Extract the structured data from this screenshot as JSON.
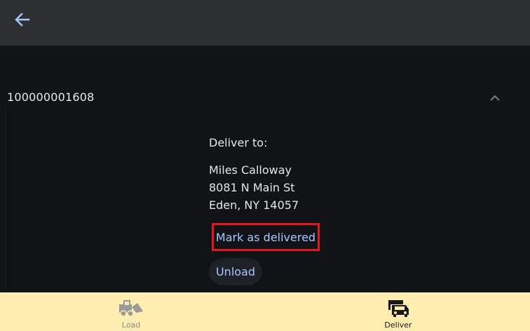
{
  "appbar": {
    "back_icon": "arrow-left-icon"
  },
  "order": {
    "id": "100000001608",
    "collapse_icon": "chevron-up-icon"
  },
  "delivery": {
    "label": "Deliver to:",
    "name": "Miles Calloway",
    "street": "8081 N Main St",
    "city_line": "Eden, NY 14057"
  },
  "actions": {
    "mark_delivered": "Mark as delivered",
    "unload": "Unload"
  },
  "bottom_nav": {
    "load": {
      "label": "Load",
      "icon": "loader-truck-icon"
    },
    "deliver": {
      "label": "Deliver",
      "icon": "delivery-vehicle-icon",
      "selected": true
    }
  },
  "colors": {
    "accent": "#a9c7ff",
    "highlight": "#e0191e",
    "nav_bg": "#ffeeb0",
    "appbar_bg": "#2d2f33",
    "page_bg": "#111317"
  }
}
